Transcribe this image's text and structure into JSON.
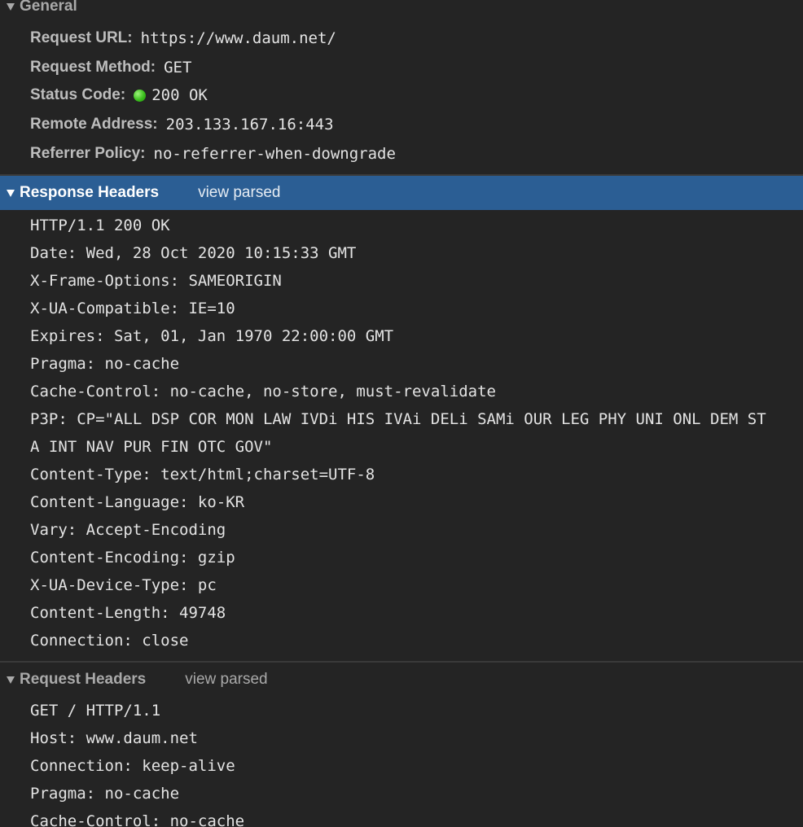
{
  "general": {
    "title": "General",
    "rows": [
      {
        "label": "Request URL:",
        "value": "https://www.daum.net/"
      },
      {
        "label": "Request Method:",
        "value": "GET"
      },
      {
        "label": "Status Code:",
        "value": "200 OK",
        "status_color": "#3bbf1d"
      },
      {
        "label": "Remote Address:",
        "value": "203.133.167.16:443"
      },
      {
        "label": "Referrer Policy:",
        "value": "no-referrer-when-downgrade"
      }
    ]
  },
  "response_headers": {
    "title": "Response Headers",
    "view_parsed_label": "view parsed",
    "lines": [
      "HTTP/1.1 200 OK",
      "Date: Wed, 28 Oct 2020 10:15:33 GMT",
      "X-Frame-Options: SAMEORIGIN",
      "X-UA-Compatible: IE=10",
      "Expires: Sat, 01, Jan 1970 22:00:00 GMT",
      "Pragma: no-cache",
      "Cache-Control: no-cache, no-store, must-revalidate",
      "P3P: CP=\"ALL DSP COR MON LAW IVDi HIS IVAi DELi SAMi OUR LEG PHY UNI ONL DEM ST",
      "A INT NAV PUR FIN OTC GOV\"",
      "Content-Type: text/html;charset=UTF-8",
      "Content-Language: ko-KR",
      "Vary: Accept-Encoding",
      "Content-Encoding: gzip",
      "X-UA-Device-Type: pc",
      "Content-Length: 49748",
      "Connection: close"
    ]
  },
  "request_headers": {
    "title": "Request Headers",
    "view_parsed_label": "view parsed",
    "lines": [
      "GET / HTTP/1.1",
      "Host: www.daum.net",
      "Connection: keep-alive",
      "Pragma: no-cache",
      "Cache-Control: no-cache"
    ]
  },
  "colors": {
    "background": "#242424",
    "selected_header": "#2b5e94",
    "status_ok": "#3bbf1d"
  }
}
